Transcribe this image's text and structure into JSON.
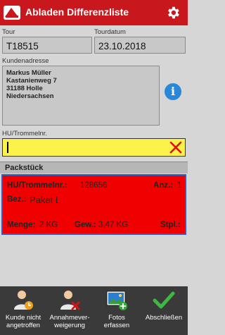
{
  "appbar": {
    "title": "Abladen Differenzliste",
    "logo_text": "LOGO"
  },
  "tour": {
    "label": "Tour",
    "value": "T18515"
  },
  "tourdatum": {
    "label": "Tourdatum",
    "value": "23.10.2018"
  },
  "kundenadresse": {
    "label": "Kundenadresse",
    "lines": [
      "Markus Müller",
      "Kastanienweg 7",
      "31188 Holle",
      "Niedersachsen"
    ]
  },
  "hu_input": {
    "label": "HU/Trommelnr.",
    "value": ""
  },
  "section": {
    "title": "Packstück"
  },
  "packstueck": {
    "hu_label": "HU/Trommelnr.:",
    "hu_value": "128656",
    "anz_label": "Anz.:",
    "anz_value": "1",
    "bez_label": "Bez.:",
    "bez_value": "Paket L",
    "menge_label": "Menge:",
    "menge_value": "2 KG",
    "gew_label": "Gew.:",
    "gew_value": "3,47 KG",
    "stpl_label": "Stpl.:",
    "stpl_value": "",
    "background": "#ff0000",
    "border": "#2a5fc4"
  },
  "toolbar": {
    "items": [
      {
        "label_line1": "Kunde nicht",
        "label_line2": "angetroffen",
        "icon": "person-clock-icon"
      },
      {
        "label_line1": "Annahmever-",
        "label_line2": "weigerung",
        "icon": "person-reject-icon"
      },
      {
        "label_line1": "Fotos",
        "label_line2": "erfassen",
        "icon": "photo-add-icon"
      },
      {
        "label_line1": "Abschließen",
        "label_line2": "",
        "icon": "checkmark-icon"
      }
    ]
  },
  "colors": {
    "appbar": "#c8181d",
    "input_highlight": "#fbf34a",
    "toolbar": "#3a3a3a",
    "info": "#2a86d6"
  }
}
